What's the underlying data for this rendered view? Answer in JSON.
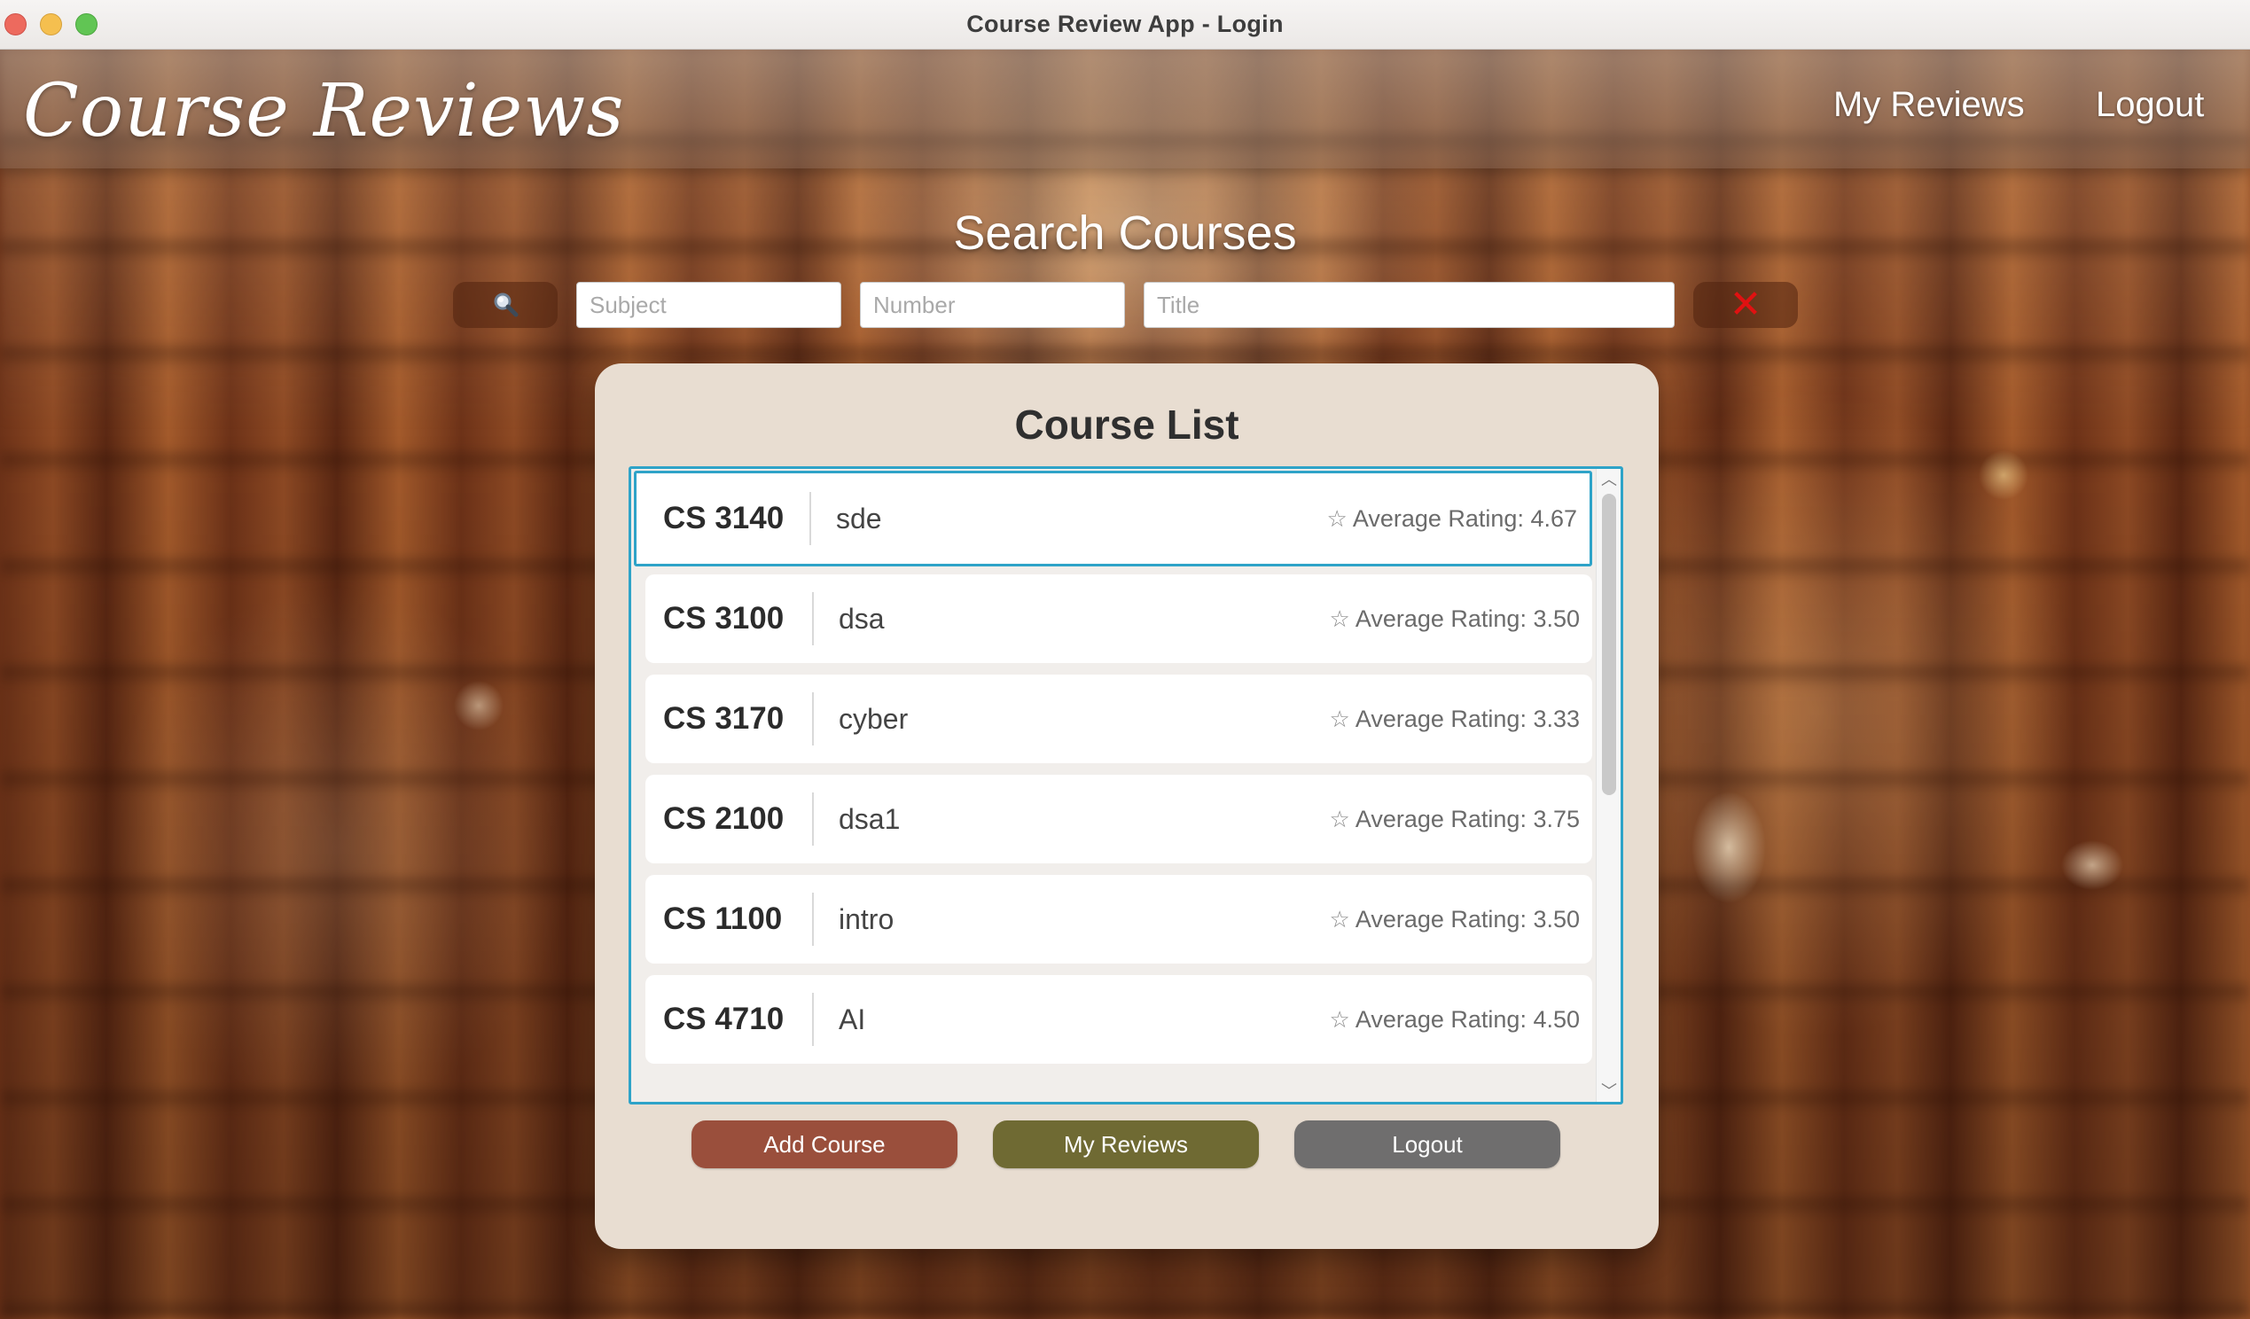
{
  "window": {
    "title": "Course Review App - Login"
  },
  "header": {
    "brand": "Course Reviews",
    "nav": {
      "my_reviews": "My Reviews",
      "logout": "Logout"
    }
  },
  "search": {
    "heading": "Search Courses",
    "search_icon": "magnifier-icon",
    "subject_placeholder": "Subject",
    "number_placeholder": "Number",
    "title_placeholder": "Title",
    "subject_value": "",
    "number_value": "",
    "title_value": "",
    "clear_label": "✕",
    "clear_color": "#e01111"
  },
  "course_list": {
    "title": "Course List",
    "star_icon": "star-outline-icon",
    "selected_index": 0,
    "courses": [
      {
        "code": "CS 3140",
        "name": "sde",
        "rating": "Average Rating: 4.67"
      },
      {
        "code": "CS 3100",
        "name": "dsa",
        "rating": "Average Rating: 3.50"
      },
      {
        "code": "CS 3170",
        "name": "cyber",
        "rating": "Average Rating: 3.33"
      },
      {
        "code": "CS 2100",
        "name": "dsa1",
        "rating": "Average Rating: 3.75"
      },
      {
        "code": "CS 1100",
        "name": "intro",
        "rating": "Average Rating: 3.50"
      },
      {
        "code": "CS 4710",
        "name": "AI",
        "rating": "Average Rating: 4.50"
      }
    ]
  },
  "actions": {
    "add_course": "Add Course",
    "my_reviews": "My Reviews",
    "logout": "Logout"
  },
  "colors": {
    "accent_border": "#2ea3c8",
    "panel_bg": "#e8ddd1",
    "add_course_btn": "#9a4f3c",
    "my_reviews_btn": "#6f6a33",
    "logout_btn": "#6f6e6e"
  }
}
